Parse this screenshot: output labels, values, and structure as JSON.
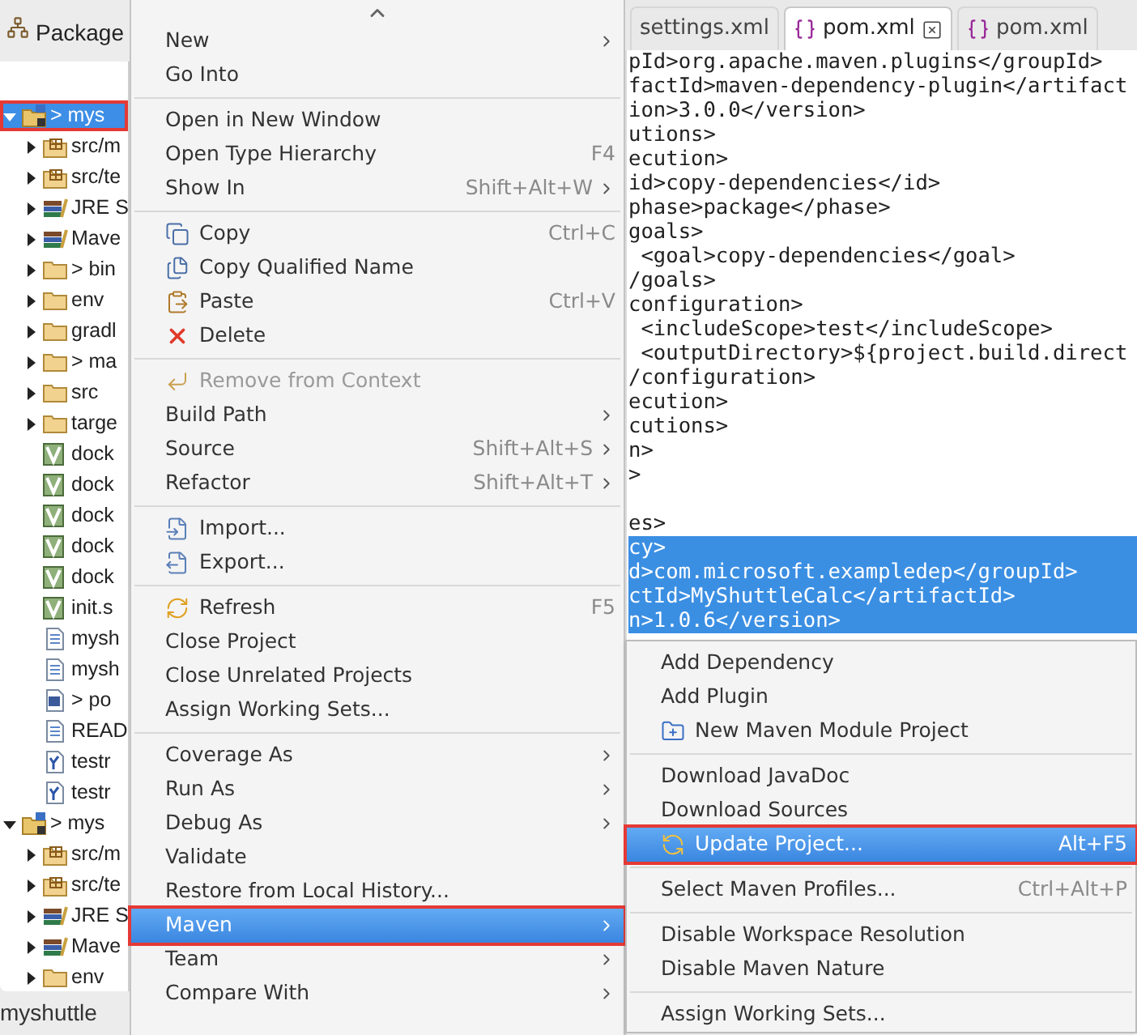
{
  "explorer": {
    "tab": {
      "label": "Package"
    },
    "tree": [
      {
        "label": "> mys",
        "kind": "project",
        "expanded": true,
        "selected": true,
        "callout": true,
        "children": [
          {
            "label": "src/m",
            "kind": "source",
            "expanded": false,
            "selected": false
          },
          {
            "label": "src/te",
            "kind": "source",
            "expanded": false,
            "selected": false
          },
          {
            "label": "JRE S",
            "kind": "library",
            "expanded": false,
            "selected": false
          },
          {
            "label": "Mave",
            "kind": "library",
            "expanded": false,
            "selected": false
          },
          {
            "label": "> bin",
            "kind": "folder",
            "expanded": false,
            "selected": false
          },
          {
            "label": "env",
            "kind": "folder",
            "expanded": false,
            "selected": false
          },
          {
            "label": "gradl",
            "kind": "folder",
            "expanded": false,
            "selected": false
          },
          {
            "label": "> ma",
            "kind": "folder",
            "expanded": false,
            "selected": false
          },
          {
            "label": "src",
            "kind": "folder",
            "expanded": false,
            "selected": false
          },
          {
            "label": "targe",
            "kind": "folder",
            "expanded": false,
            "selected": false
          },
          {
            "label": "dock",
            "kind": "script",
            "selected": false
          },
          {
            "label": "dock",
            "kind": "script",
            "selected": false
          },
          {
            "label": "dock",
            "kind": "script",
            "selected": false
          },
          {
            "label": "dock",
            "kind": "script",
            "selected": false
          },
          {
            "label": "dock",
            "kind": "script",
            "selected": false
          },
          {
            "label": "init.s",
            "kind": "script",
            "selected": false
          },
          {
            "label": "mysh",
            "kind": "text",
            "selected": false
          },
          {
            "label": "mysh",
            "kind": "text",
            "selected": false
          },
          {
            "label": "> po",
            "kind": "maven",
            "selected": false
          },
          {
            "label": "READ",
            "kind": "text",
            "selected": false
          },
          {
            "label": "testr",
            "kind": "yaml",
            "selected": false
          },
          {
            "label": "testr",
            "kind": "yaml",
            "selected": false
          }
        ]
      },
      {
        "label": "> mys",
        "kind": "project",
        "expanded": true,
        "selected": false,
        "children": [
          {
            "label": "src/m",
            "kind": "source",
            "expanded": false,
            "selected": false
          },
          {
            "label": "src/te",
            "kind": "source",
            "expanded": false,
            "selected": false
          },
          {
            "label": "JRE S",
            "kind": "library",
            "expanded": false,
            "selected": false
          },
          {
            "label": "Mave",
            "kind": "library",
            "expanded": false,
            "selected": false
          },
          {
            "label": "env",
            "kind": "folder",
            "expanded": false,
            "selected": false
          }
        ]
      }
    ]
  },
  "status_bar": {
    "text": "myshuttle"
  },
  "context_menu": {
    "groups": [
      [
        {
          "label": "New",
          "kind": "plain",
          "submenu": true,
          "selected": false
        },
        {
          "label": "Go Into",
          "kind": "plain",
          "submenu": false,
          "selected": false
        }
      ],
      [
        {
          "label": "Open in New Window",
          "kind": "plain",
          "submenu": false,
          "selected": false
        },
        {
          "label": "Open Type Hierarchy",
          "kind": "plain",
          "shortcut": "F4",
          "submenu": false,
          "selected": false
        },
        {
          "label": "Show In",
          "kind": "plain",
          "shortcut": "Shift+Alt+W",
          "submenu": true,
          "selected": false
        }
      ],
      [
        {
          "label": "Copy",
          "kind": "copy",
          "shortcut": "Ctrl+C",
          "submenu": false,
          "selected": false
        },
        {
          "label": "Copy Qualified Name",
          "kind": "copy-name",
          "submenu": false,
          "selected": false
        },
        {
          "label": "Paste",
          "kind": "paste",
          "shortcut": "Ctrl+V",
          "submenu": false,
          "selected": false
        },
        {
          "label": "Delete",
          "kind": "delete",
          "submenu": false,
          "selected": false
        }
      ],
      [
        {
          "label": "Remove from Context",
          "kind": "remove",
          "submenu": false,
          "selected": false,
          "disabled": true
        },
        {
          "label": "Build Path",
          "kind": "plain",
          "submenu": true,
          "selected": false
        },
        {
          "label": "Source",
          "kind": "plain",
          "shortcut": "Shift+Alt+S",
          "submenu": true,
          "selected": false
        },
        {
          "label": "Refactor",
          "kind": "plain",
          "shortcut": "Shift+Alt+T",
          "submenu": true,
          "selected": false
        }
      ],
      [
        {
          "label": "Import...",
          "kind": "import",
          "submenu": false,
          "selected": false
        },
        {
          "label": "Export...",
          "kind": "export",
          "submenu": false,
          "selected": false
        }
      ],
      [
        {
          "label": "Refresh",
          "kind": "refresh",
          "shortcut": "F5",
          "submenu": false,
          "selected": false
        },
        {
          "label": "Close Project",
          "kind": "plain",
          "submenu": false,
          "selected": false
        },
        {
          "label": "Close Unrelated Projects",
          "kind": "plain",
          "submenu": false,
          "selected": false
        },
        {
          "label": "Assign Working Sets...",
          "kind": "plain",
          "submenu": false,
          "selected": false
        }
      ],
      [
        {
          "label": "Coverage As",
          "kind": "plain",
          "submenu": true,
          "selected": false
        },
        {
          "label": "Run As",
          "kind": "plain",
          "submenu": true,
          "selected": false
        },
        {
          "label": "Debug As",
          "kind": "plain",
          "submenu": true,
          "selected": false
        },
        {
          "label": "Validate",
          "kind": "plain",
          "submenu": false,
          "selected": false
        },
        {
          "label": "Restore from Local History...",
          "kind": "plain",
          "submenu": false,
          "selected": false
        },
        {
          "label": "Maven",
          "kind": "plain",
          "submenu": true,
          "selected": true,
          "callout": true
        },
        {
          "label": "Team",
          "kind": "plain",
          "submenu": true,
          "selected": false
        },
        {
          "label": "Compare With",
          "kind": "plain",
          "submenu": true,
          "selected": false
        }
      ]
    ]
  },
  "editor": {
    "tabs": [
      {
        "label": "settings.xml",
        "selected": false
      },
      {
        "label": "pom.xml",
        "selected": true
      },
      {
        "label": "pom.xml",
        "selected": false
      }
    ],
    "lines": [
      {
        "text": "pId>org.apache.maven.plugins</groupId>",
        "selected": false
      },
      {
        "text": "factId>maven-dependency-plugin</artifact",
        "selected": false
      },
      {
        "text": "ion>3.0.0</version>",
        "selected": false
      },
      {
        "text": "utions>",
        "selected": false
      },
      {
        "text": "ecution>",
        "selected": false
      },
      {
        "text": "id>copy-dependencies</id>",
        "selected": false
      },
      {
        "text": "phase>package</phase>",
        "selected": false
      },
      {
        "text": "goals>",
        "selected": false
      },
      {
        "text": " <goal>copy-dependencies</goal>",
        "selected": false
      },
      {
        "text": "/goals>",
        "selected": false
      },
      {
        "text": "configuration>",
        "selected": false
      },
      {
        "text": " <includeScope>test</includeScope>",
        "selected": false
      },
      {
        "text": " <outputDirectory>${project.build.direct",
        "selected": false
      },
      {
        "text": "/configuration>",
        "selected": false
      },
      {
        "text": "ecution>",
        "selected": false
      },
      {
        "text": "cutions>",
        "selected": false
      },
      {
        "text": "n>",
        "selected": false
      },
      {
        "text": ">",
        "selected": false
      },
      {
        "blank": true
      },
      {
        "text": "es>",
        "selected": false
      },
      {
        "text": "cy>",
        "selected": true
      },
      {
        "text": "d>com.microsoft.exampledep</groupId>",
        "selected": true
      },
      {
        "text": "ctId>MyShuttleCalc</artifactId>",
        "selected": true
      },
      {
        "text": "n>1.0.6</version>",
        "selected": true
      }
    ]
  },
  "submenu": {
    "groups": [
      [
        {
          "label": "Add Dependency",
          "kind": "plain",
          "selected": false
        },
        {
          "label": "Add Plugin",
          "kind": "plain",
          "selected": false
        },
        {
          "label": "New Maven Module Project",
          "kind": "new-module",
          "selected": false
        }
      ],
      [
        {
          "label": "Download JavaDoc",
          "kind": "plain",
          "selected": false
        },
        {
          "label": "Download Sources",
          "kind": "plain",
          "selected": false
        },
        {
          "label": "Update Project...",
          "kind": "update",
          "shortcut": "Alt+F5",
          "selected": true,
          "callout": true
        }
      ],
      [
        {
          "label": "Select Maven Profiles...",
          "kind": "plain",
          "shortcut": "Ctrl+Alt+P",
          "selected": false
        }
      ],
      [
        {
          "label": "Disable Workspace Resolution",
          "kind": "plain",
          "selected": false
        },
        {
          "label": "Disable Maven Nature",
          "kind": "plain",
          "selected": false
        }
      ],
      [
        {
          "label": "Assign Working Sets...",
          "kind": "plain",
          "selected": false
        }
      ]
    ]
  }
}
